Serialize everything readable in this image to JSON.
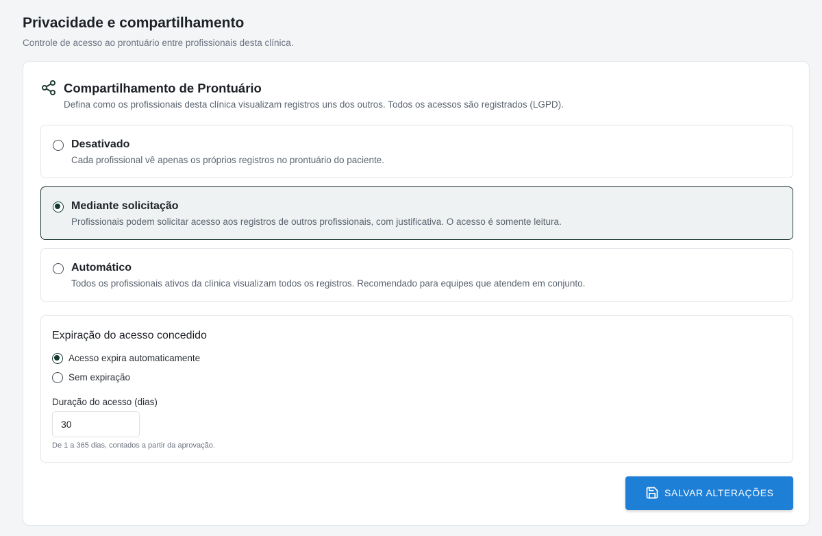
{
  "header": {
    "title": "Privacidade e compartilhamento",
    "subtitle": "Controle de acesso ao prontuário entre profissionais desta clínica."
  },
  "section": {
    "icon": "share-icon",
    "title": "Compartilhamento de Prontuário",
    "description": "Defina como os profissionais desta clínica visualizam registros uns dos outros. Todos os acessos são registrados (LGPD)."
  },
  "sharing_options": [
    {
      "title": "Desativado",
      "description": "Cada profissional vê apenas os próprios registros no prontuário do paciente.",
      "selected": false
    },
    {
      "title": "Mediante solicitação",
      "description": "Profissionais podem solicitar acesso aos registros de outros profissionais, com justificativa. O acesso é somente leitura.",
      "selected": true
    },
    {
      "title": "Automático",
      "description": "Todos os profissionais ativos da clínica visualizam todos os registros. Recomendado para equipes que atendem em conjunto.",
      "selected": false
    }
  ],
  "expiry": {
    "title": "Expiração do acesso concedido",
    "options": [
      {
        "label": "Acesso expira automaticamente",
        "selected": true
      },
      {
        "label": "Sem expiração",
        "selected": false
      }
    ],
    "duration_label": "Duração do acesso (dias)",
    "duration_value": "30",
    "hint": "De 1 a 365 dias, contados a partir da aprovação."
  },
  "actions": {
    "save_icon": "save-icon",
    "save_label": "SALVAR ALTERAÇÕES"
  },
  "colors": {
    "primary_button": "#1e7fd6",
    "selected_border": "#233a37",
    "selected_background": "#eef2f2",
    "radio_checked": "#163a33"
  }
}
